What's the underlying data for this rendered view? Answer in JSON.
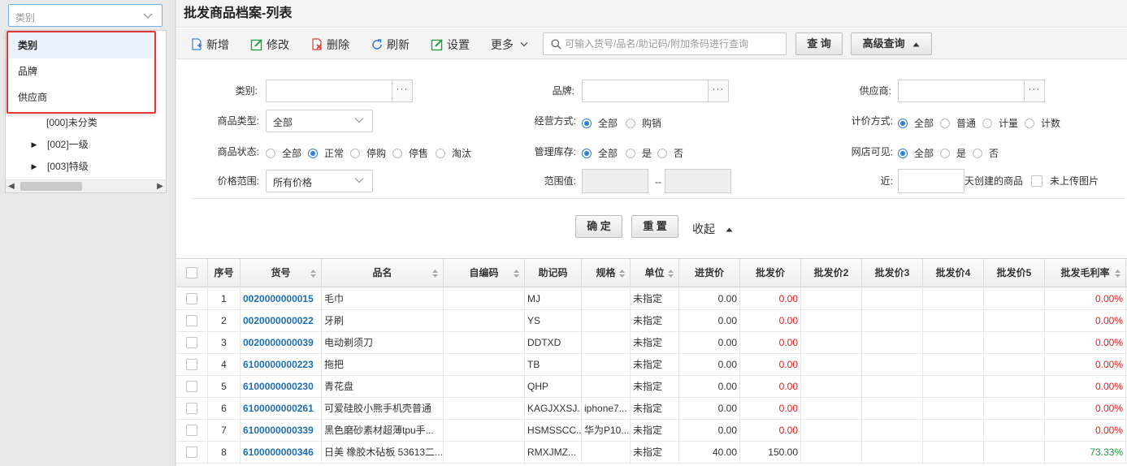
{
  "sidebar": {
    "category_select_value": "类别",
    "tree": [
      {
        "label": "[000]未分类",
        "expandable": false
      },
      {
        "label": "[002]一级",
        "expandable": true
      },
      {
        "label": "[003]特级",
        "expandable": true
      }
    ],
    "dropdown_options": [
      "类别",
      "品牌",
      "供应商"
    ]
  },
  "page": {
    "title": "批发商品档案-列表"
  },
  "toolbar": {
    "add": "新增",
    "edit": "修改",
    "delete": "删除",
    "refresh": "刷新",
    "settings": "设置",
    "more": "更多",
    "search_placeholder": "可输入货号/品名/助记码/附加条码进行查询",
    "query": "查 询",
    "advanced_query": "高级查询"
  },
  "filters": {
    "category_label": "类别:",
    "brand_label": "品牌:",
    "supplier_label": "供应商:",
    "goods_type_label": "商品类型:",
    "goods_type_value": "全部",
    "biz_mode_label": "经营方式:",
    "biz_mode_options": [
      "全部",
      "购销"
    ],
    "pricing_label": "计价方式:",
    "pricing_options": [
      "全部",
      "普通",
      "计量",
      "计数"
    ],
    "status_label": "商品状态:",
    "status_options": [
      "全部",
      "正常",
      "停购",
      "停售",
      "淘汰"
    ],
    "stock_label": "管理库存:",
    "stock_options": [
      "全部",
      "是",
      "否"
    ],
    "shop_label": "网店可见:",
    "shop_options": [
      "全部",
      "是",
      "否"
    ],
    "price_range_label": "价格范围:",
    "price_range_value": "所有价格",
    "range_value_label": "范围值:",
    "range_sep": "--",
    "recent_label": "近:",
    "recent_suffix": "天创建的商品",
    "no_image_label": "未上传图片",
    "confirm": "确 定",
    "reset": "重 置",
    "collapse": "收起"
  },
  "grid": {
    "columns": [
      "序号",
      "货号",
      "品名",
      "自编码",
      "助记码",
      "规格",
      "单位",
      "进货价",
      "批发价",
      "批发价2",
      "批发价3",
      "批发价4",
      "批发价5",
      "批发毛利率"
    ],
    "rows": [
      {
        "no": "1",
        "code": "0020000000015",
        "name": "毛巾",
        "selfcode": "",
        "mnemonic": "MJ",
        "spec": "",
        "unit": "未指定",
        "cost": "0.00",
        "price": "0.00",
        "margin": "0.00%"
      },
      {
        "no": "2",
        "code": "0020000000022",
        "name": "牙刷",
        "selfcode": "",
        "mnemonic": "YS",
        "spec": "",
        "unit": "未指定",
        "cost": "0.00",
        "price": "0.00",
        "margin": "0.00%"
      },
      {
        "no": "3",
        "code": "0020000000039",
        "name": "电动剃须刀",
        "selfcode": "",
        "mnemonic": "DDTXD",
        "spec": "",
        "unit": "未指定",
        "cost": "0.00",
        "price": "0.00",
        "margin": "0.00%"
      },
      {
        "no": "4",
        "code": "6100000000223",
        "name": "拖把",
        "selfcode": "",
        "mnemonic": "TB",
        "spec": "",
        "unit": "未指定",
        "cost": "0.00",
        "price": "0.00",
        "margin": "0.00%"
      },
      {
        "no": "5",
        "code": "6100000000230",
        "name": "青花盘",
        "selfcode": "",
        "mnemonic": "QHP",
        "spec": "",
        "unit": "未指定",
        "cost": "0.00",
        "price": "0.00",
        "margin": "0.00%"
      },
      {
        "no": "6",
        "code": "6100000000261",
        "name": "可爱硅胶小熊手机壳普通",
        "selfcode": "",
        "mnemonic": "KAGJXXSJ...",
        "spec": "iphone7...",
        "unit": "未指定",
        "cost": "0.00",
        "price": "0.00",
        "margin": "0.00%"
      },
      {
        "no": "7",
        "code": "6100000000339",
        "name": "黑色磨砂素材超薄tpu手...",
        "selfcode": "",
        "mnemonic": "HSMSSCC...",
        "spec": "华为P10...",
        "unit": "未指定",
        "cost": "0.00",
        "price": "0.00",
        "margin": "0.00%"
      },
      {
        "no": "8",
        "code": "6100000000346",
        "name": "日美 橡胶木砧板 53613二...",
        "selfcode": "",
        "mnemonic": "RMXJMZ...",
        "spec": "",
        "unit": "未指定",
        "cost": "40.00",
        "price": "150.00",
        "margin": "73.33%"
      }
    ]
  },
  "colors": {
    "accent": "#2f7ed8",
    "code_link": "#1f6fb2",
    "negative": "#e02020",
    "positive": "#1e9b3c",
    "dropdown_border": "#e03b3b"
  }
}
